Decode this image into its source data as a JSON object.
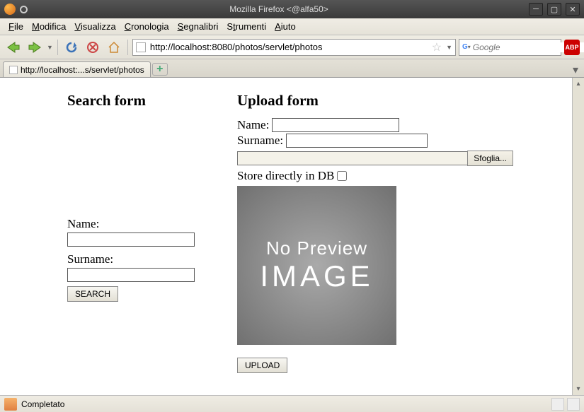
{
  "window": {
    "title": "Mozilla Firefox <@alfa50>"
  },
  "menu": {
    "file": "File",
    "edit": "Modifica",
    "view": "Visualizza",
    "history": "Cronologia",
    "bookmarks": "Segnalibri",
    "tools": "Strumenti",
    "help": "Aiuto"
  },
  "toolbar": {
    "url": "http://localhost:8080/photos/servlet/photos",
    "search_placeholder": "Google"
  },
  "tabs": {
    "active": "http://localhost:...s/servlet/photos"
  },
  "page": {
    "search": {
      "heading": "Search form",
      "name_label": "Name:",
      "surname_label": "Surname:",
      "button": "SEARCH"
    },
    "upload": {
      "heading": "Upload form",
      "name_label": "Name:",
      "surname_label": "Surname:",
      "browse_label": "Sfoglia...",
      "store_label": "Store directly in DB",
      "preview_line1": "No Preview",
      "preview_line2": "IMAGE",
      "button": "UPLOAD"
    }
  },
  "status": {
    "text": "Completato"
  }
}
